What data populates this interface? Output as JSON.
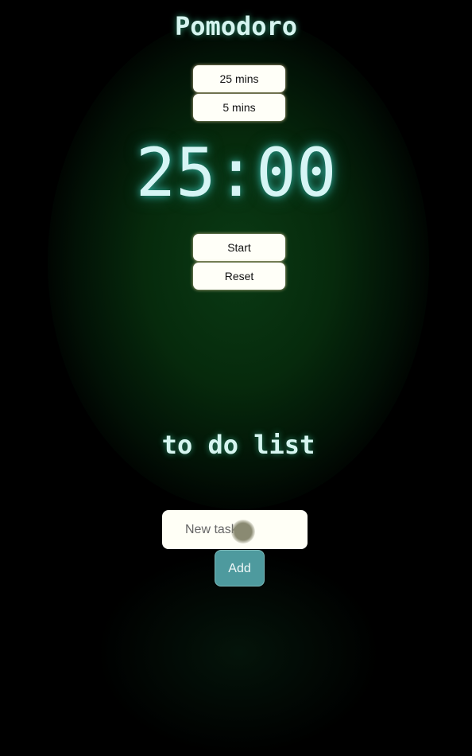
{
  "header": {
    "title": "Pomodoro"
  },
  "durations": [
    {
      "label": "25 mins"
    },
    {
      "label": "5 mins"
    }
  ],
  "timer": {
    "display": "25:00"
  },
  "controls": {
    "start": "Start",
    "reset": "Reset"
  },
  "todo": {
    "title": "to do list",
    "input_placeholder": "New task",
    "input_value": "",
    "add_label": "Add"
  },
  "colors": {
    "accent": "#4e9a9e",
    "text_glow": "#d6f5f0",
    "background": "#000000"
  }
}
